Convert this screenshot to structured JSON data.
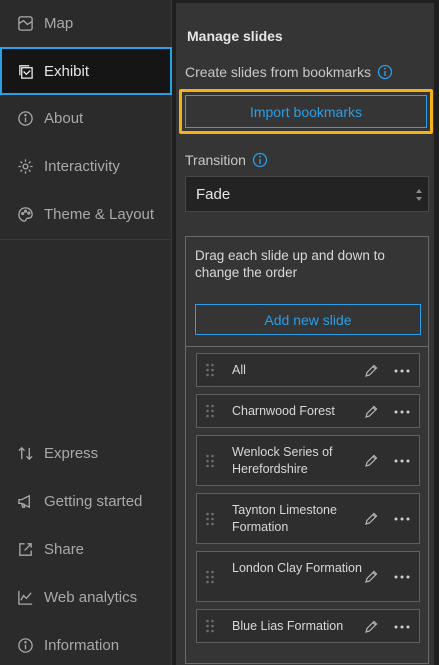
{
  "nav": {
    "items": [
      {
        "label": "Map",
        "icon": "map-icon"
      },
      {
        "label": "Exhibit",
        "icon": "exhibit-icon",
        "active": true
      },
      {
        "label": "About",
        "icon": "info-icon"
      },
      {
        "label": "Interactivity",
        "icon": "gear-icon"
      },
      {
        "label": "Theme & Layout",
        "icon": "palette-icon"
      },
      {
        "label": "Express",
        "icon": "express-icon"
      },
      {
        "label": "Getting started",
        "icon": "megaphone-icon"
      },
      {
        "label": "Share",
        "icon": "share-icon"
      },
      {
        "label": "Web analytics",
        "icon": "analytics-icon"
      },
      {
        "label": "Information",
        "icon": "information-icon"
      }
    ]
  },
  "panel": {
    "title": "Manage slides",
    "create_label": "Create slides from bookmarks",
    "import_button": "Import bookmarks",
    "transition_label": "Transition",
    "transition_value": "Fade",
    "drag_hint": "Drag each slide up and down to change the order",
    "add_button": "Add new slide",
    "slides": [
      {
        "name": "All"
      },
      {
        "name": "Charnwood Forest"
      },
      {
        "name": "Wenlock Series of Herefordshire"
      },
      {
        "name": "Taynton Limestone Formation"
      },
      {
        "name": "London Clay Formation"
      },
      {
        "name": "Blue Lias Formation"
      }
    ]
  },
  "colors": {
    "accent": "#2a9ee8",
    "highlight": "#f3b21b"
  }
}
